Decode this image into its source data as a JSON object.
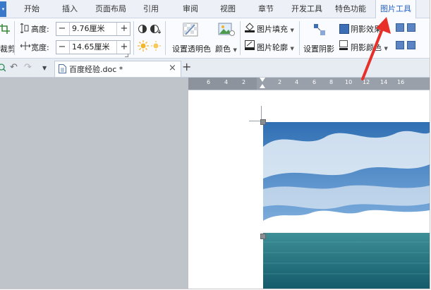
{
  "menu_tabs": [
    {
      "label": "开始"
    },
    {
      "label": "插入"
    },
    {
      "label": "页面布局"
    },
    {
      "label": "引用"
    },
    {
      "label": "审阅"
    },
    {
      "label": "视图"
    },
    {
      "label": "章节"
    },
    {
      "label": "开发工具"
    },
    {
      "label": "特色功能"
    },
    {
      "label": "图片工具",
      "active": true
    }
  ],
  "ribbon": {
    "crop_label": "裁剪",
    "height_label": "高度:",
    "height_value": "9.76厘米",
    "width_label": "宽度:",
    "width_value": "14.65厘米",
    "set_transparent_label": "设置透明色",
    "color_label": "颜色",
    "picture_fill_label": "图片填充",
    "picture_outline_label": "图片轮廓",
    "set_shadow_label": "设置阴影",
    "shadow_effect_label": "阴影效果",
    "shadow_color_label": "阴影颜色",
    "minus": "−",
    "plus": "+"
  },
  "quickbar": {
    "doc_tab_title": "百度经验.doc *",
    "close_glyph": "×",
    "new_tab_glyph": "+"
  },
  "ruler": {
    "ticks": [
      "6",
      "4",
      "2",
      "2",
      "4",
      "6",
      "8",
      "10",
      "12",
      "14",
      "16"
    ]
  },
  "colors": {
    "accent": "#2563c4",
    "arrow": "#e8302a",
    "workspace": "#bfc3ca"
  }
}
